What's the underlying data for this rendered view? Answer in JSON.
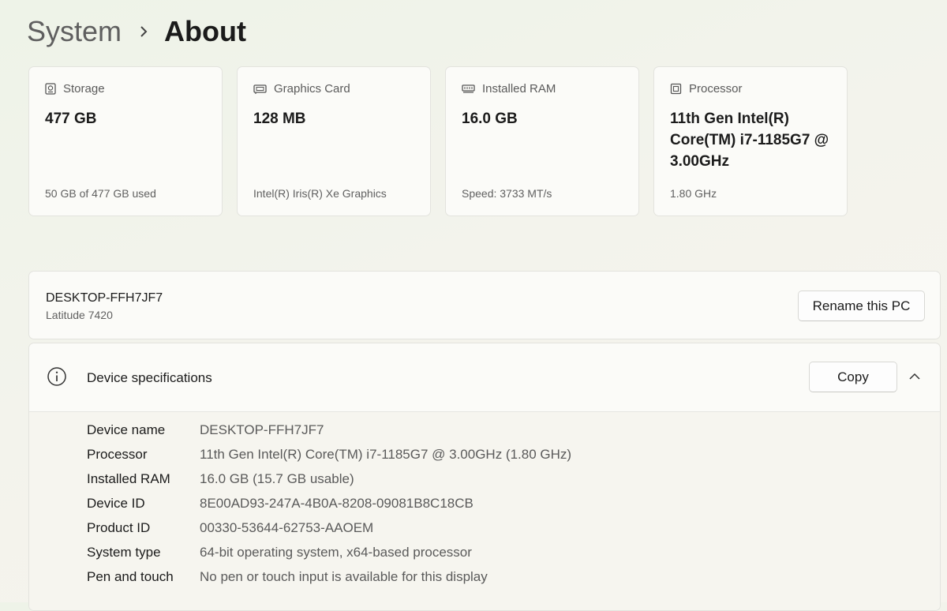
{
  "breadcrumb": {
    "parent": "System",
    "current": "About"
  },
  "cards": [
    {
      "icon": "storage-icon",
      "title": "Storage",
      "value": "477 GB",
      "sub": "50 GB of 477 GB used"
    },
    {
      "icon": "graphics-card-icon",
      "title": "Graphics Card",
      "value": "128 MB",
      "sub": "Intel(R) Iris(R) Xe Graphics"
    },
    {
      "icon": "ram-icon",
      "title": "Installed RAM",
      "value": "16.0 GB",
      "sub": "Speed: 3733 MT/s"
    },
    {
      "icon": "processor-icon",
      "title": "Processor",
      "value": "11th Gen Intel(R) Core(TM) i7-1185G7 @ 3.00GHz",
      "sub": "1.80 GHz"
    }
  ],
  "pc": {
    "name": "DESKTOP-FFH7JF7",
    "model": "Latitude 7420",
    "rename_label": "Rename this PC"
  },
  "specs": {
    "title": "Device specifications",
    "copy_label": "Copy",
    "rows": [
      {
        "label": "Device name",
        "value": "DESKTOP-FFH7JF7"
      },
      {
        "label": "Processor",
        "value": "11th Gen Intel(R) Core(TM) i7-1185G7 @ 3.00GHz (1.80 GHz)"
      },
      {
        "label": "Installed RAM",
        "value": "16.0 GB (15.7 GB usable)"
      },
      {
        "label": "Device ID",
        "value": "8E00AD93-247A-4B0A-8208-09081B8C18CB"
      },
      {
        "label": "Product ID",
        "value": "00330-53644-62753-AAOEM"
      },
      {
        "label": "System type",
        "value": "64-bit operating system, x64-based processor"
      },
      {
        "label": "Pen and touch",
        "value": "No pen or touch input is available for this display"
      }
    ]
  }
}
